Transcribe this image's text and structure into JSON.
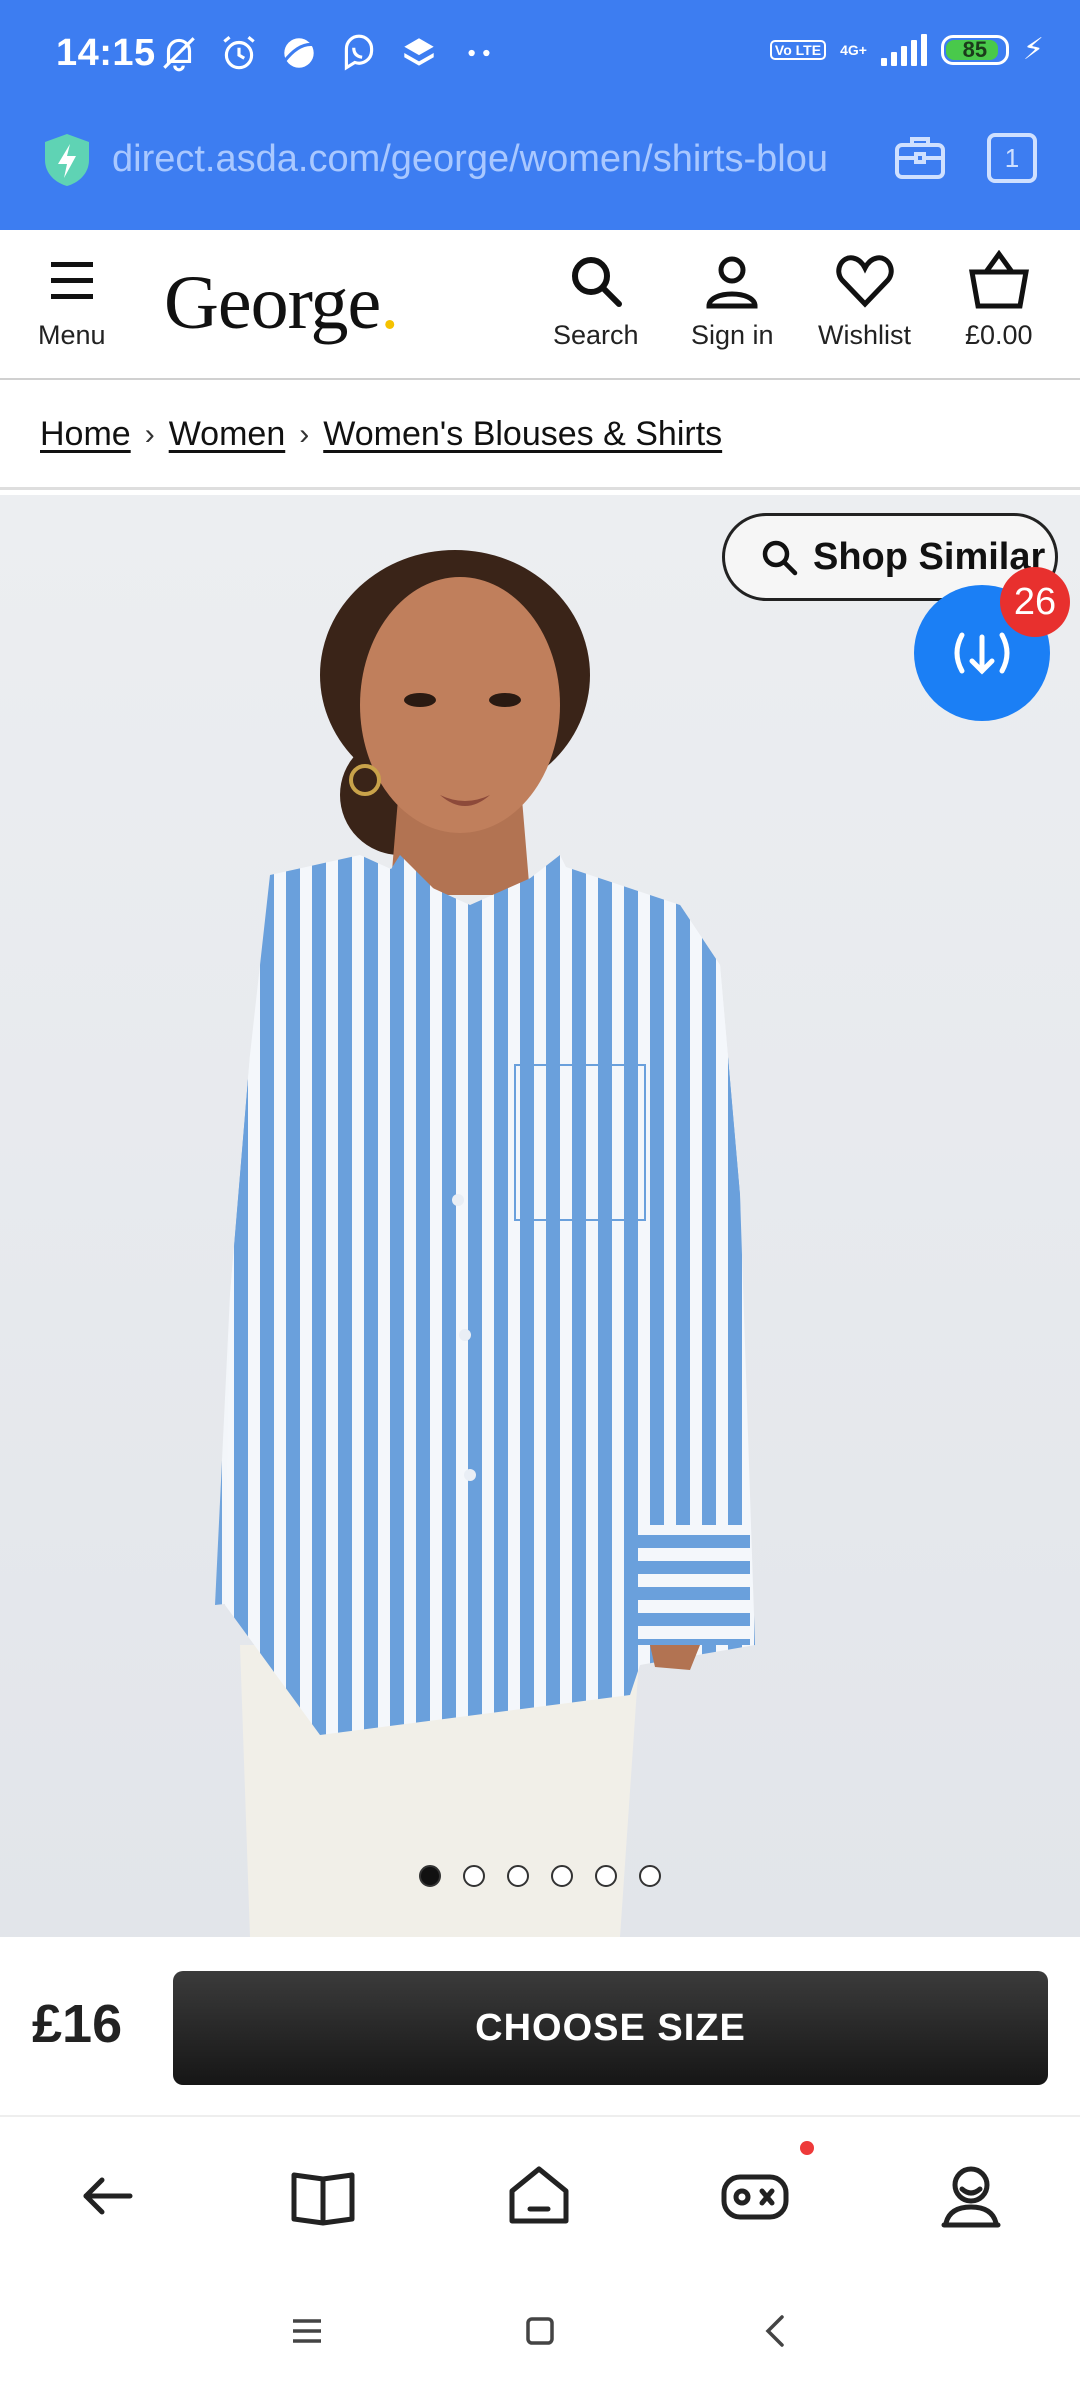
{
  "status_bar": {
    "time": "14:15",
    "volte": "Vo LTE",
    "network": "4G+",
    "battery": "85"
  },
  "browser": {
    "url": "direct.asda.com/george/women/shirts-blou",
    "tab_count": "1"
  },
  "header": {
    "menu_label": "Menu",
    "logo_text": "George",
    "logo_dot": ".",
    "search_label": "Search",
    "signin_label": "Sign in",
    "wishlist_label": "Wishlist",
    "basket_label": "£0.00"
  },
  "breadcrumb": {
    "items": [
      "Home",
      "Women",
      "Women's Blouses & Shirts"
    ]
  },
  "product": {
    "shop_similar_label": "Shop Similar",
    "fab_badge": "26",
    "image_count": 6,
    "active_image_index": 0,
    "price": "£16",
    "cta_label": "CHOOSE SIZE"
  },
  "colors": {
    "browser_blue": "#3d7df1",
    "fab_blue": "#1b7ff5",
    "badge_red": "#e8302e",
    "cta_dark": "#1e1e1e",
    "shirt_stripe": "#6aa0dc"
  }
}
